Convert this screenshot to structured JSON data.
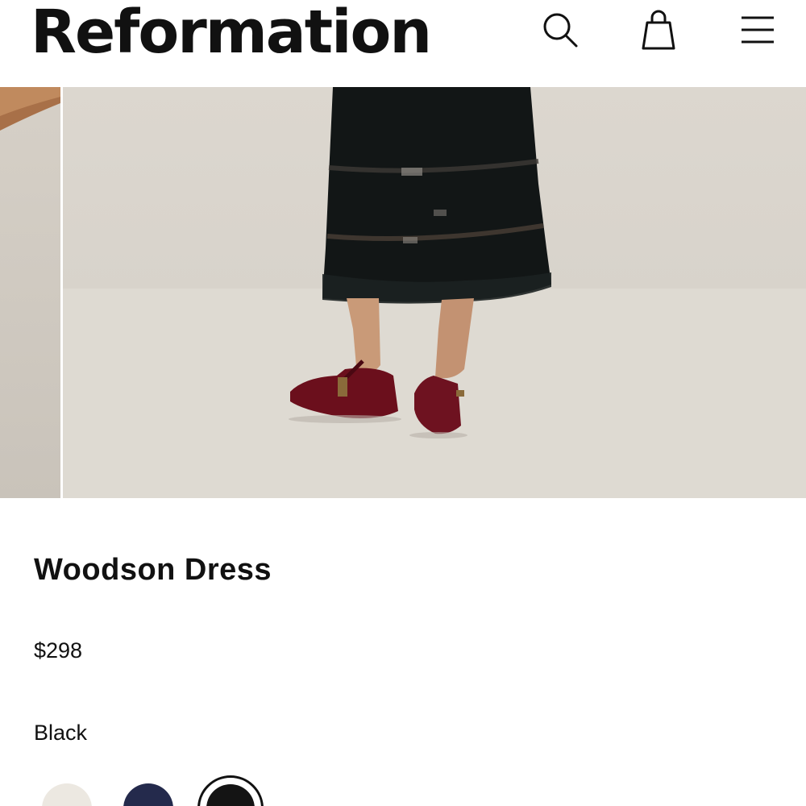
{
  "header": {
    "logo_text": "Reformation",
    "icons": [
      "search-icon",
      "shopping-bag-icon",
      "hamburger-menu-icon"
    ]
  },
  "gallery": {
    "current_image": "model wearing black dress with velvet burgundy flats"
  },
  "product": {
    "name": "Woodson Dress",
    "price": "$298",
    "selected_color": "Black",
    "swatches": [
      {
        "name": "Ivory",
        "hex": "#ece8e1"
      },
      {
        "name": "Navy",
        "hex": "#242a4c"
      },
      {
        "name": "Black",
        "hex": "#141414",
        "selected": true
      }
    ]
  }
}
